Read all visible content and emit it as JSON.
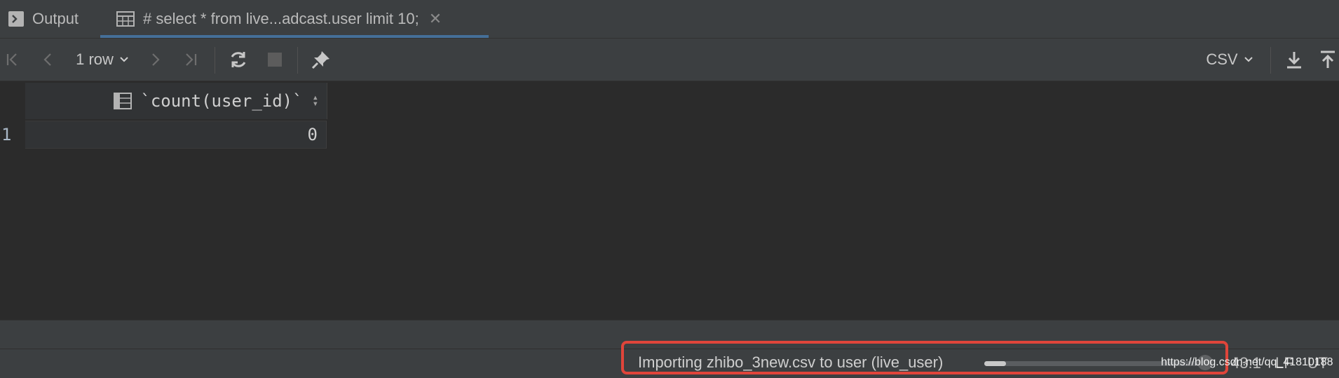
{
  "tabs": [
    {
      "label": "Output",
      "icon": "console-icon"
    },
    {
      "label": "# select * from live...adcast.user limit 10;",
      "icon": "table-icon",
      "active": true
    }
  ],
  "toolbar": {
    "rows_label": "1 row",
    "export_format": "CSV"
  },
  "grid": {
    "column_header": "`count(user_id)`",
    "rows": [
      {
        "row_number": "1",
        "value": "0"
      }
    ]
  },
  "status": {
    "progress_text": "Importing zhibo_3new.csv to user (live_user)",
    "progress_fraction": 0.1,
    "cursor_position": "43:1",
    "line_separator": "LF",
    "encoding": "UT",
    "watermark": "https://blog.csdn.net/qq_41810188"
  },
  "colors": {
    "accent": "#4a88c7",
    "highlight": "#e0453a"
  }
}
